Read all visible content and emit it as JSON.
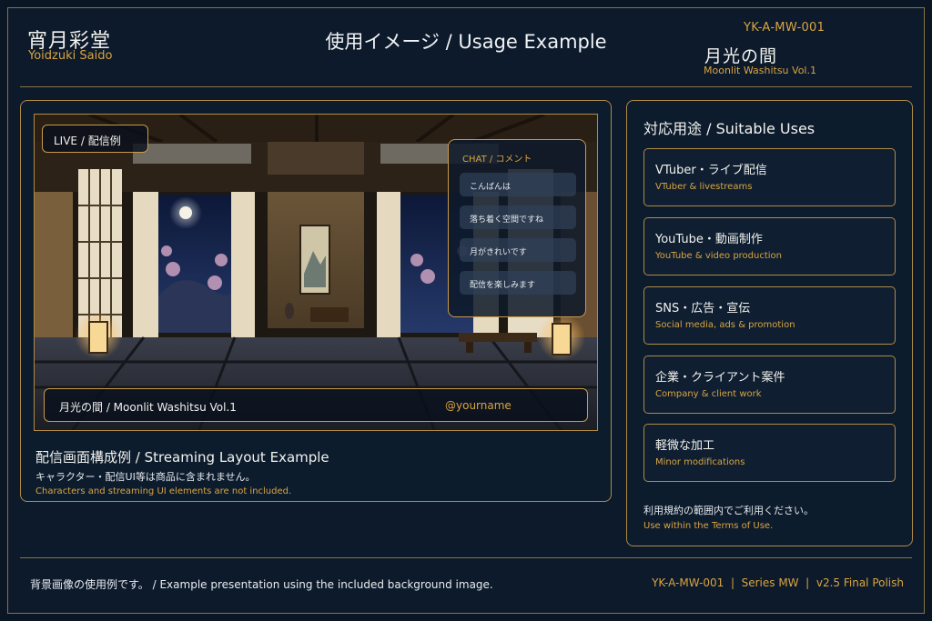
{
  "brand": {
    "name_jp": "宵月彩堂",
    "name_en": "Yoidzuki Saido"
  },
  "page_title": "使用イメージ / Usage Example",
  "product": {
    "code": "YK-A-MW-001",
    "name_jp": "月光の間",
    "name_en": "Moonlit Washitsu Vol.1"
  },
  "preview": {
    "live_badge": "LIVE / 配信例",
    "chat": {
      "title": "CHAT / コメント",
      "messages": [
        "こんばんは",
        "落ち着く空間ですね",
        "月がきれいです",
        "配信を楽しみます"
      ]
    },
    "lower_third": {
      "title": "月光の間 / Moonlit Washitsu Vol.1",
      "handle": "@yourname"
    }
  },
  "caption": {
    "title": "配信画面構成例 / Streaming Layout Example",
    "note_jp": "キャラクター・配信UI等は商品に含まれません。",
    "note_en": "Characters and streaming UI elements are not included."
  },
  "uses": {
    "title": "対応用途 / Suitable Uses",
    "items": [
      {
        "jp": "VTuber・ライブ配信",
        "en": "VTuber & livestreams"
      },
      {
        "jp": "YouTube・動画制作",
        "en": "YouTube & video production"
      },
      {
        "jp": "SNS・広告・宣伝",
        "en": "Social media, ads & promotion"
      },
      {
        "jp": "企業・クライアント案件",
        "en": "Company & client work"
      },
      {
        "jp": "軽微な加工",
        "en": "Minor modifications"
      }
    ],
    "terms_jp": "利用規約の範囲内でご利用ください。",
    "terms_en": "Use within the Terms of Use."
  },
  "footer": {
    "note": "背景画像の使用例です。 / Example presentation using the included background image.",
    "meta": "YK-A-MW-001  |  Series MW  |  v2.5 Final Polish"
  },
  "colors": {
    "gold": "#d9a441",
    "border": "#b08a45",
    "background": "#0c1a2b"
  }
}
